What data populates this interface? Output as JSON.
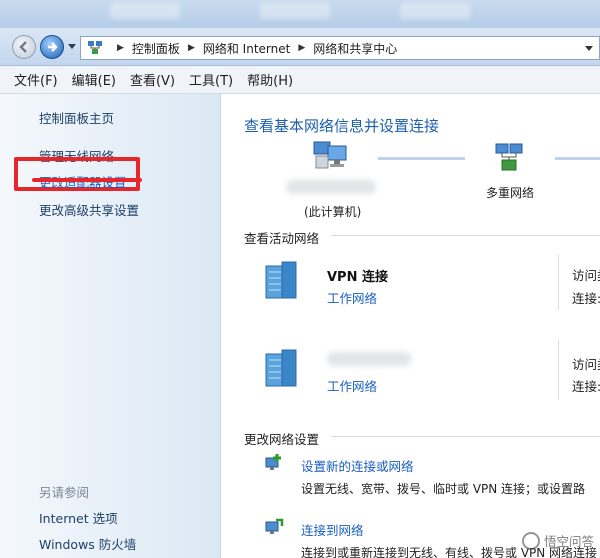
{
  "window": {
    "address_bar": {
      "breadcrumbs": [
        "控制面板",
        "网络和 Internet",
        "网络和共享中心"
      ]
    }
  },
  "menu": {
    "items": [
      "文件(F)",
      "编辑(E)",
      "查看(V)",
      "工具(T)",
      "帮助(H)"
    ]
  },
  "sidebar": {
    "home": "控制面板主页",
    "links": [
      "管理无线网络",
      "更改适配器设置",
      "更改高级共享设置"
    ],
    "see_also_title": "另请参阅",
    "see_also": [
      "Internet 选项",
      "Windows 防火墙"
    ]
  },
  "main": {
    "title": "查看基本网络信息并设置连接",
    "map": {
      "this_computer_caption": "(此计算机)",
      "network_caption": "多重网络"
    },
    "active_section_title": "查看活动网络",
    "networks": [
      {
        "name": "VPN 连接",
        "type": "工作网络",
        "access_label": "访问类",
        "conn_label": "连接:"
      },
      {
        "name": "",
        "type": "工作网络",
        "access_label": "访问类",
        "conn_label": "连接:"
      }
    ],
    "change_section_title": "更改网络设置",
    "tasks": [
      {
        "link": "设置新的连接或网络",
        "desc": "设置无线、宽带、拨号、临时或 VPN 连接；或设置路"
      },
      {
        "link": "连接到网络",
        "desc": "连接到或重新连接到无线、有线、拨号或 VPN 网络连接"
      }
    ]
  },
  "watermark": "悟空问答",
  "colors": {
    "link": "#1a5fc4",
    "title": "#1d5fae",
    "highlight": "#e6262a"
  }
}
